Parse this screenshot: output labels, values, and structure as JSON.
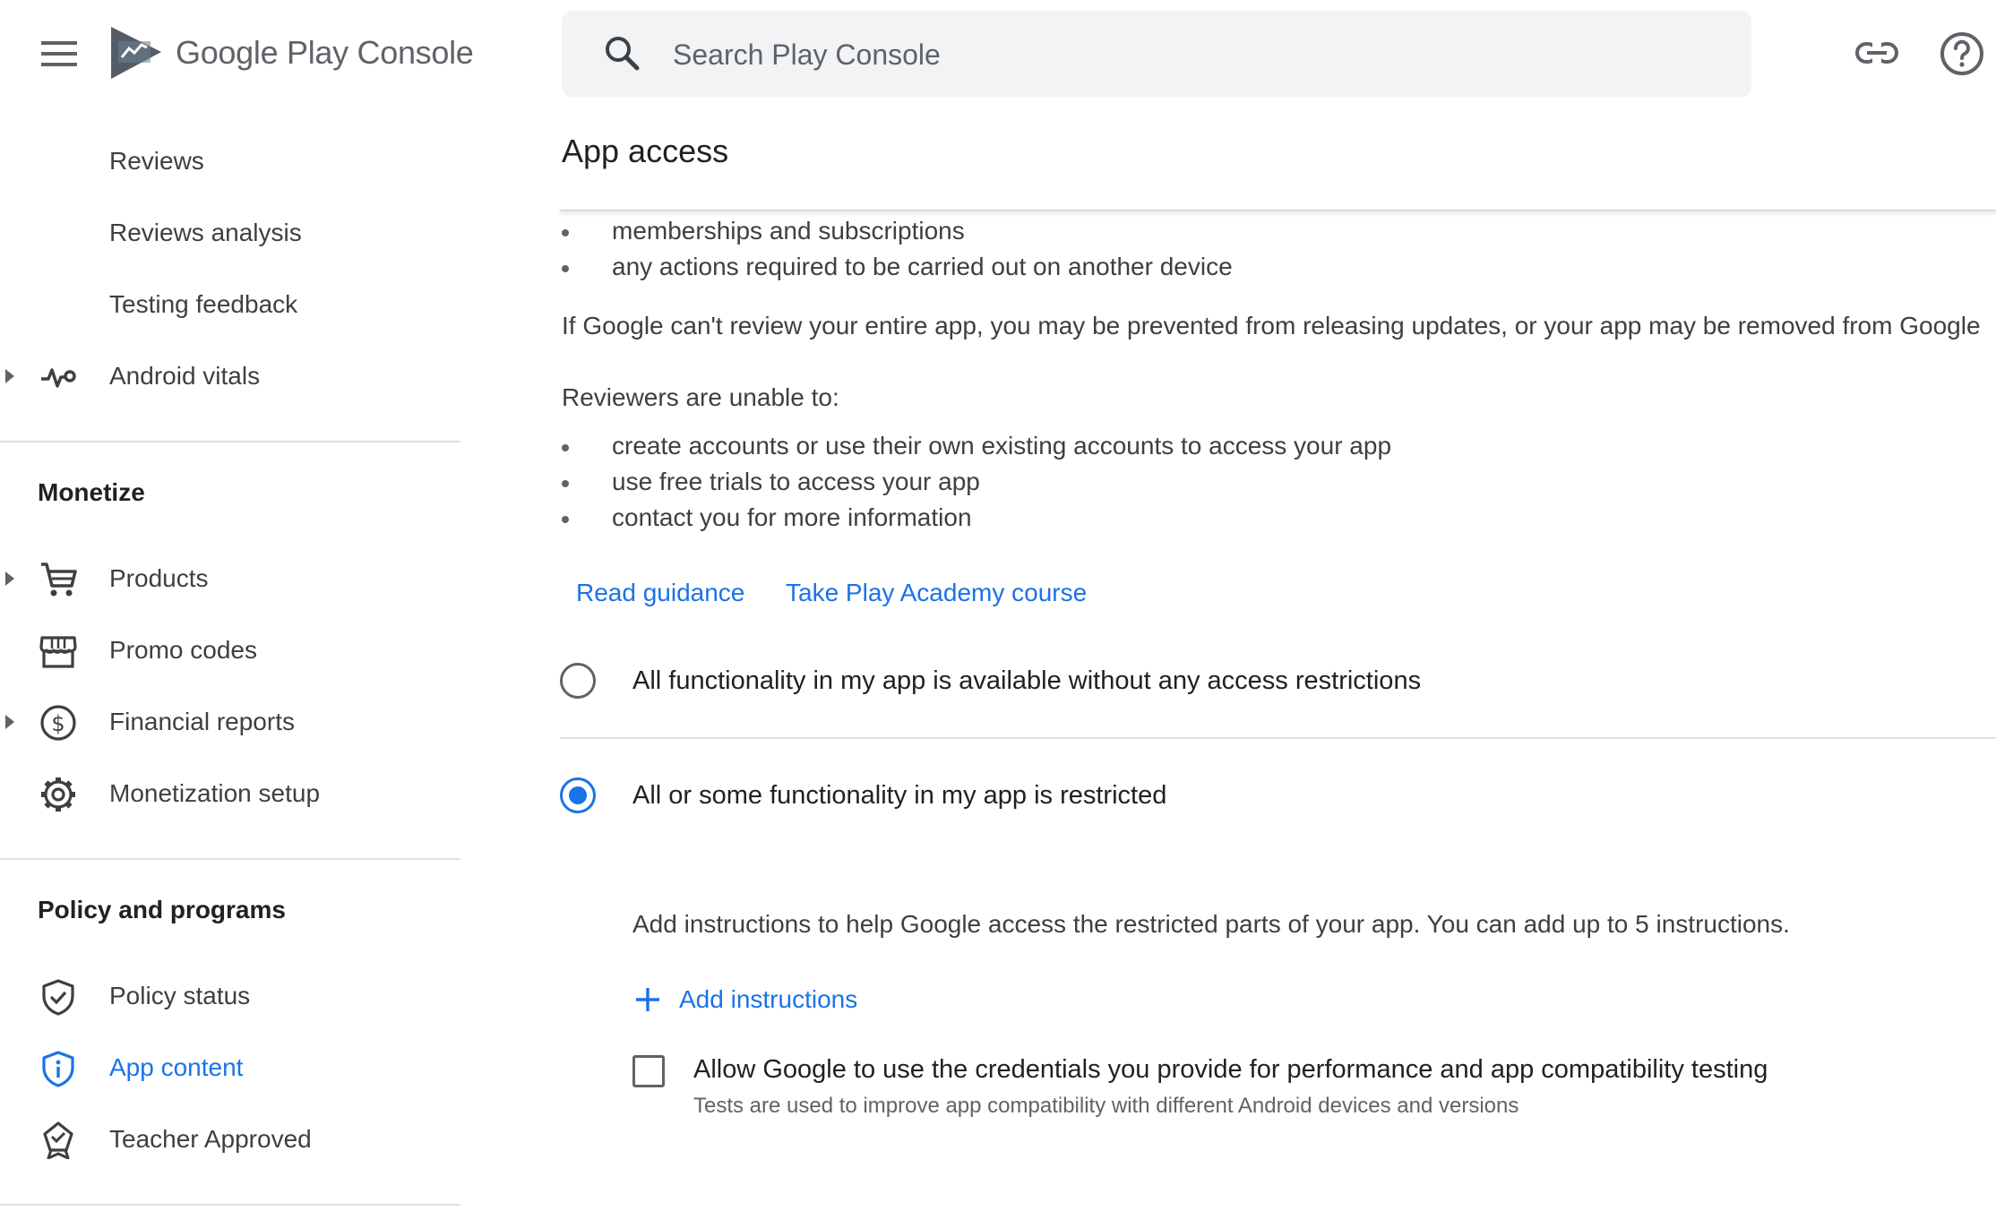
{
  "header": {
    "brand": {
      "google_play": "Google Play",
      "console": "Console"
    },
    "search": {
      "placeholder": "Search Play Console",
      "value": ""
    },
    "icons": [
      "menu-icon",
      "play-console-logo",
      "search-icon",
      "link-icon",
      "help-icon"
    ]
  },
  "sidebar": {
    "top_items": [
      {
        "label": "Reviews"
      },
      {
        "label": "Reviews analysis"
      },
      {
        "label": "Testing feedback"
      },
      {
        "label": "Android vitals",
        "icon": "vitals-icon",
        "expandable": true
      }
    ],
    "monetize": {
      "heading": "Monetize",
      "items": [
        {
          "label": "Products",
          "icon": "cart-icon",
          "expandable": true
        },
        {
          "label": "Promo codes",
          "icon": "store-icon"
        },
        {
          "label": "Financial reports",
          "icon": "dollar-icon",
          "expandable": true
        },
        {
          "label": "Monetization setup",
          "icon": "gear-icon"
        }
      ]
    },
    "policy": {
      "heading": "Policy and programs",
      "items": [
        {
          "label": "Policy status",
          "icon": "shield-check-icon"
        },
        {
          "label": "App content",
          "icon": "shield-info-icon",
          "active": true
        },
        {
          "label": "Teacher Approved",
          "icon": "badge-icon"
        }
      ]
    }
  },
  "main": {
    "title": "App access",
    "list_top": [
      "memberships and subscriptions",
      "any actions required to be carried out on another device"
    ],
    "warning": "If Google can't review your entire app, you may be prevented from releasing updates, or your app may be removed from Google",
    "unable_heading": "Reviewers are unable to:",
    "unable_list": [
      "create accounts or use their own existing accounts to access your app",
      "use free trials to access your app",
      "contact you for more information"
    ],
    "links": {
      "guidance": "Read guidance",
      "academy": "Take Play Academy course"
    },
    "options": [
      {
        "label": "All functionality in my app is available without any access restrictions",
        "selected": false
      },
      {
        "label": "All or some functionality in my app is restricted",
        "selected": true
      }
    ],
    "instructions_text": "Add instructions to help Google access the restricted parts of your app. You can add up to 5 instructions.",
    "add_instructions": "Add instructions",
    "checkbox": {
      "label": "Allow Google to use the credentials you provide for performance and app compatibility testing",
      "sub": "Tests are used to improve app compatibility with different Android devices and versions",
      "checked": false
    },
    "accent_color": "#1a73e8"
  }
}
